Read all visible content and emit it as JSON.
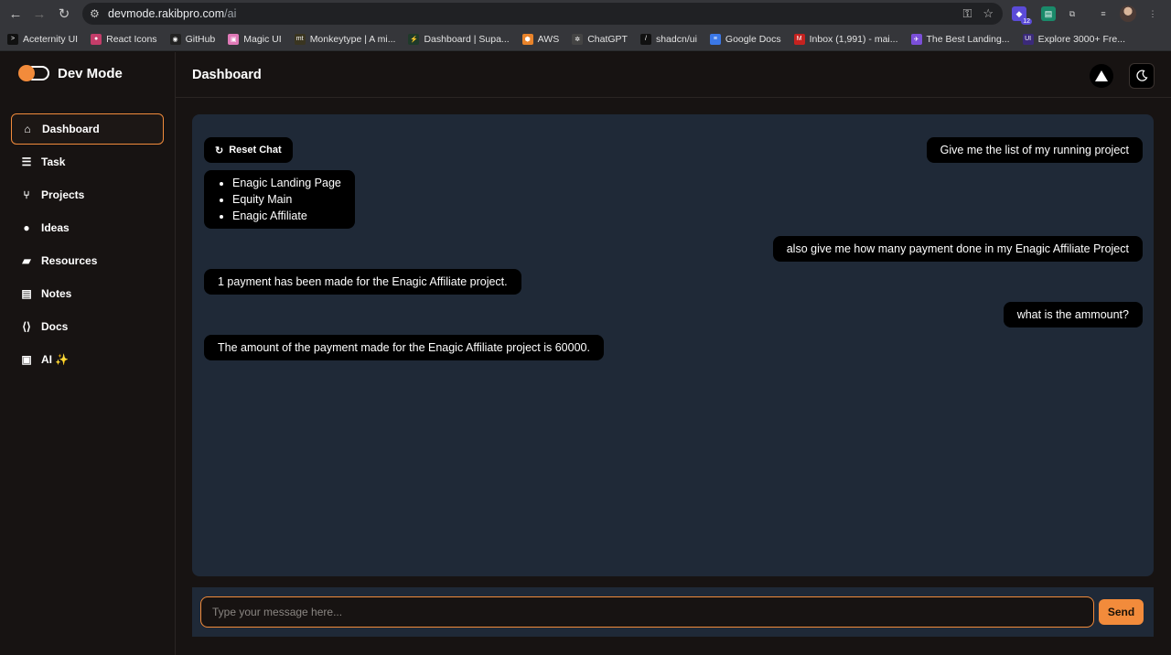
{
  "browser": {
    "url_host": "devmode.rakibpro.com",
    "url_path": "/ai",
    "extension_badge": "12",
    "bookmarks": [
      {
        "label": "Aceternity UI",
        "color": "#111111",
        "glyph": ">"
      },
      {
        "label": "React Icons",
        "color": "#c43d6a",
        "glyph": "●"
      },
      {
        "label": "GitHub",
        "color": "#222222",
        "glyph": "◉"
      },
      {
        "label": "Magic UI",
        "color": "#e07ab8",
        "glyph": "▣"
      },
      {
        "label": "Monkeytype | A mi...",
        "color": "#3a3520",
        "glyph": "mt"
      },
      {
        "label": "Dashboard | Supa...",
        "color": "#1f3a2a",
        "glyph": "⚡"
      },
      {
        "label": "AWS",
        "color": "#e8832a",
        "glyph": "⬢"
      },
      {
        "label": "ChatGPT",
        "color": "#444444",
        "glyph": "✲"
      },
      {
        "label": "shadcn/ui",
        "color": "#111111",
        "glyph": "/"
      },
      {
        "label": "Google Docs",
        "color": "#3b78e7",
        "glyph": "≡"
      },
      {
        "label": "Inbox (1,991) - mai...",
        "color": "#c5221f",
        "glyph": "M"
      },
      {
        "label": "The Best Landing...",
        "color": "#7b4fd8",
        "glyph": "✈"
      },
      {
        "label": "Explore 3000+ Fre...",
        "color": "#3b2a7a",
        "glyph": "UI"
      }
    ]
  },
  "brand": {
    "title": "Dev Mode",
    "accent": "#f28b3b"
  },
  "nav": [
    {
      "label": "Dashboard",
      "icon": "home-icon",
      "glyph": "⌂",
      "active": true
    },
    {
      "label": "Task",
      "icon": "list-icon",
      "glyph": "☰",
      "active": false
    },
    {
      "label": "Projects",
      "icon": "branch-icon",
      "glyph": "⑂",
      "active": false
    },
    {
      "label": "Ideas",
      "icon": "lightbulb-icon",
      "glyph": "●",
      "active": false
    },
    {
      "label": "Resources",
      "icon": "box-icon",
      "glyph": "▰",
      "active": false
    },
    {
      "label": "Notes",
      "icon": "note-icon",
      "glyph": "▤",
      "active": false
    },
    {
      "label": "Docs",
      "icon": "code-file-icon",
      "glyph": "⟨⟩",
      "active": false
    },
    {
      "label": "AI ✨",
      "icon": "chip-icon",
      "glyph": "▣",
      "active": false
    }
  ],
  "header": {
    "title": "Dashboard"
  },
  "chat": {
    "reset_label": "Reset Chat",
    "messages": [
      {
        "role": "user",
        "text": "Give me the list of my running project"
      },
      {
        "role": "bot",
        "items": [
          "Enagic Landing Page",
          "Equity Main",
          "Enagic Affiliate"
        ]
      },
      {
        "role": "user",
        "text": "also give me how many payment done in my Enagic Affiliate Project"
      },
      {
        "role": "bot",
        "text": "1 payment has been made for the Enagic Affiliate project."
      },
      {
        "role": "user",
        "text": "what is the ammount?"
      },
      {
        "role": "bot",
        "text": "The amount of the payment made for the Enagic Affiliate project is 60000."
      }
    ]
  },
  "composer": {
    "placeholder": "Type your message here...",
    "send_label": "Send"
  }
}
